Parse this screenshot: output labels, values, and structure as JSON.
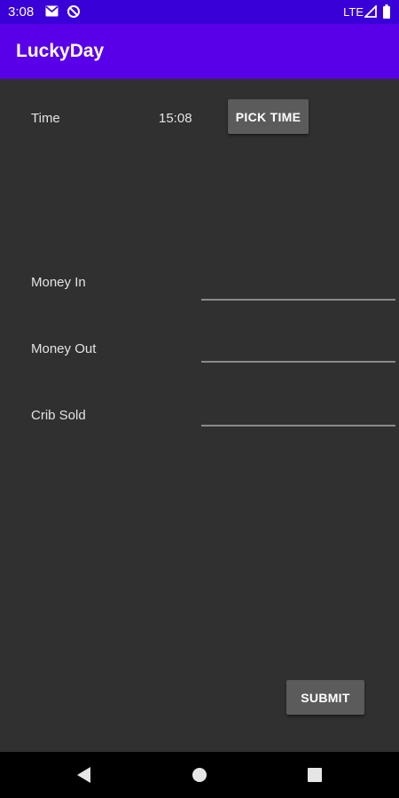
{
  "status_bar": {
    "time": "3:08",
    "network": "LTE",
    "icons": [
      "gmail-icon",
      "data-saver-icon",
      "signal-icon",
      "battery-icon"
    ]
  },
  "app_bar": {
    "title": "LuckyDay"
  },
  "form": {
    "time_label": "Time",
    "time_value": "15:08",
    "pick_time_label": "PICK TIME",
    "money_in_label": "Money In",
    "money_in_value": "",
    "money_out_label": "Money Out",
    "money_out_value": "",
    "crib_sold_label": "Crib Sold",
    "crib_sold_value": "",
    "submit_label": "SUBMIT"
  },
  "nav_bar": {
    "icons": [
      "back-icon",
      "home-icon",
      "recents-icon"
    ]
  },
  "colors": {
    "status_bar": "#3a00d8",
    "app_bar": "#5a00e9",
    "background": "#303030",
    "button": "#5b5b5b"
  }
}
